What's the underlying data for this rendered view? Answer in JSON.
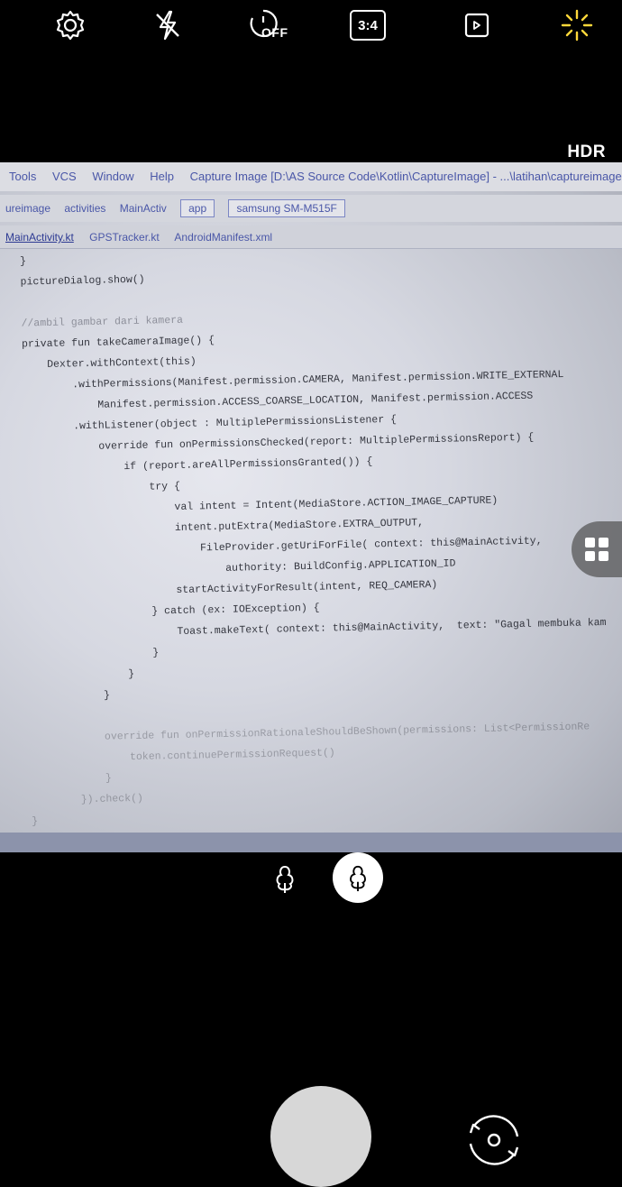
{
  "top_bar": {
    "settings_icon": "gear-icon",
    "flash_icon": "flash-off-icon",
    "timer_label": "OFF",
    "ratio_label": "3:4",
    "motion_icon": "motion-photo-icon",
    "effects_icon": "sparkle-icon"
  },
  "hdr_label": "HDR",
  "viewfinder": {
    "menubar": [
      "Tools",
      "VCS",
      "Window",
      "Help",
      "Capture Image [D:\\AS Source Code\\Kotlin\\CaptureImage] - ...\\latihan\\captureimage"
    ],
    "toolbar": [
      "ureimage",
      "activities",
      "MainActiv",
      "app",
      "samsung SM-M515F"
    ],
    "tabs": [
      "MainActivity.kt",
      "GPSTracker.kt",
      "AndroidManifest.xml"
    ],
    "code_lines": [
      "}",
      "pictureDialog.show()",
      "",
      "//ambil gambar dari kamera",
      "private fun takeCameraImage() {",
      "    Dexter.withContext(this)",
      "        .withPermissions(Manifest.permission.CAMERA, Manifest.permission.WRITE_EXTERNAL",
      "            Manifest.permission.ACCESS_COARSE_LOCATION, Manifest.permission.ACCESS",
      "        .withListener(object : MultiplePermissionsListener {",
      "            override fun onPermissionsChecked(report: MultiplePermissionsReport) {",
      "                if (report.areAllPermissionsGranted()) {",
      "                    try {",
      "                        val intent = Intent(MediaStore.ACTION_IMAGE_CAPTURE)",
      "                        intent.putExtra(MediaStore.EXTRA_OUTPUT,",
      "                            FileProvider.getUriForFile( context: this@MainActivity,",
      "                                authority: BuildConfig.APPLICATION_ID",
      "                        startActivityForResult(intent, REQ_CAMERA)",
      "                    } catch (ex: IOException) {",
      "                        Toast.makeText( context: this@MainActivity,  text: \"Gagal membuka kam",
      "                    }",
      "                }",
      "            }",
      "",
      "            override fun onPermissionRationaleShouldBeShown(permissions: List<PermissionRe",
      "                token.continuePermissionRequest()",
      "            }",
      "        }).check()",
      "}"
    ]
  },
  "floating_button_icon": "grid-icon",
  "filters": {
    "left_icon": "tree-outline-icon",
    "right_icon": "tree-selected-icon"
  },
  "bottom": {
    "shutter_icon": "shutter-button",
    "switch_icon": "switch-camera-icon"
  }
}
